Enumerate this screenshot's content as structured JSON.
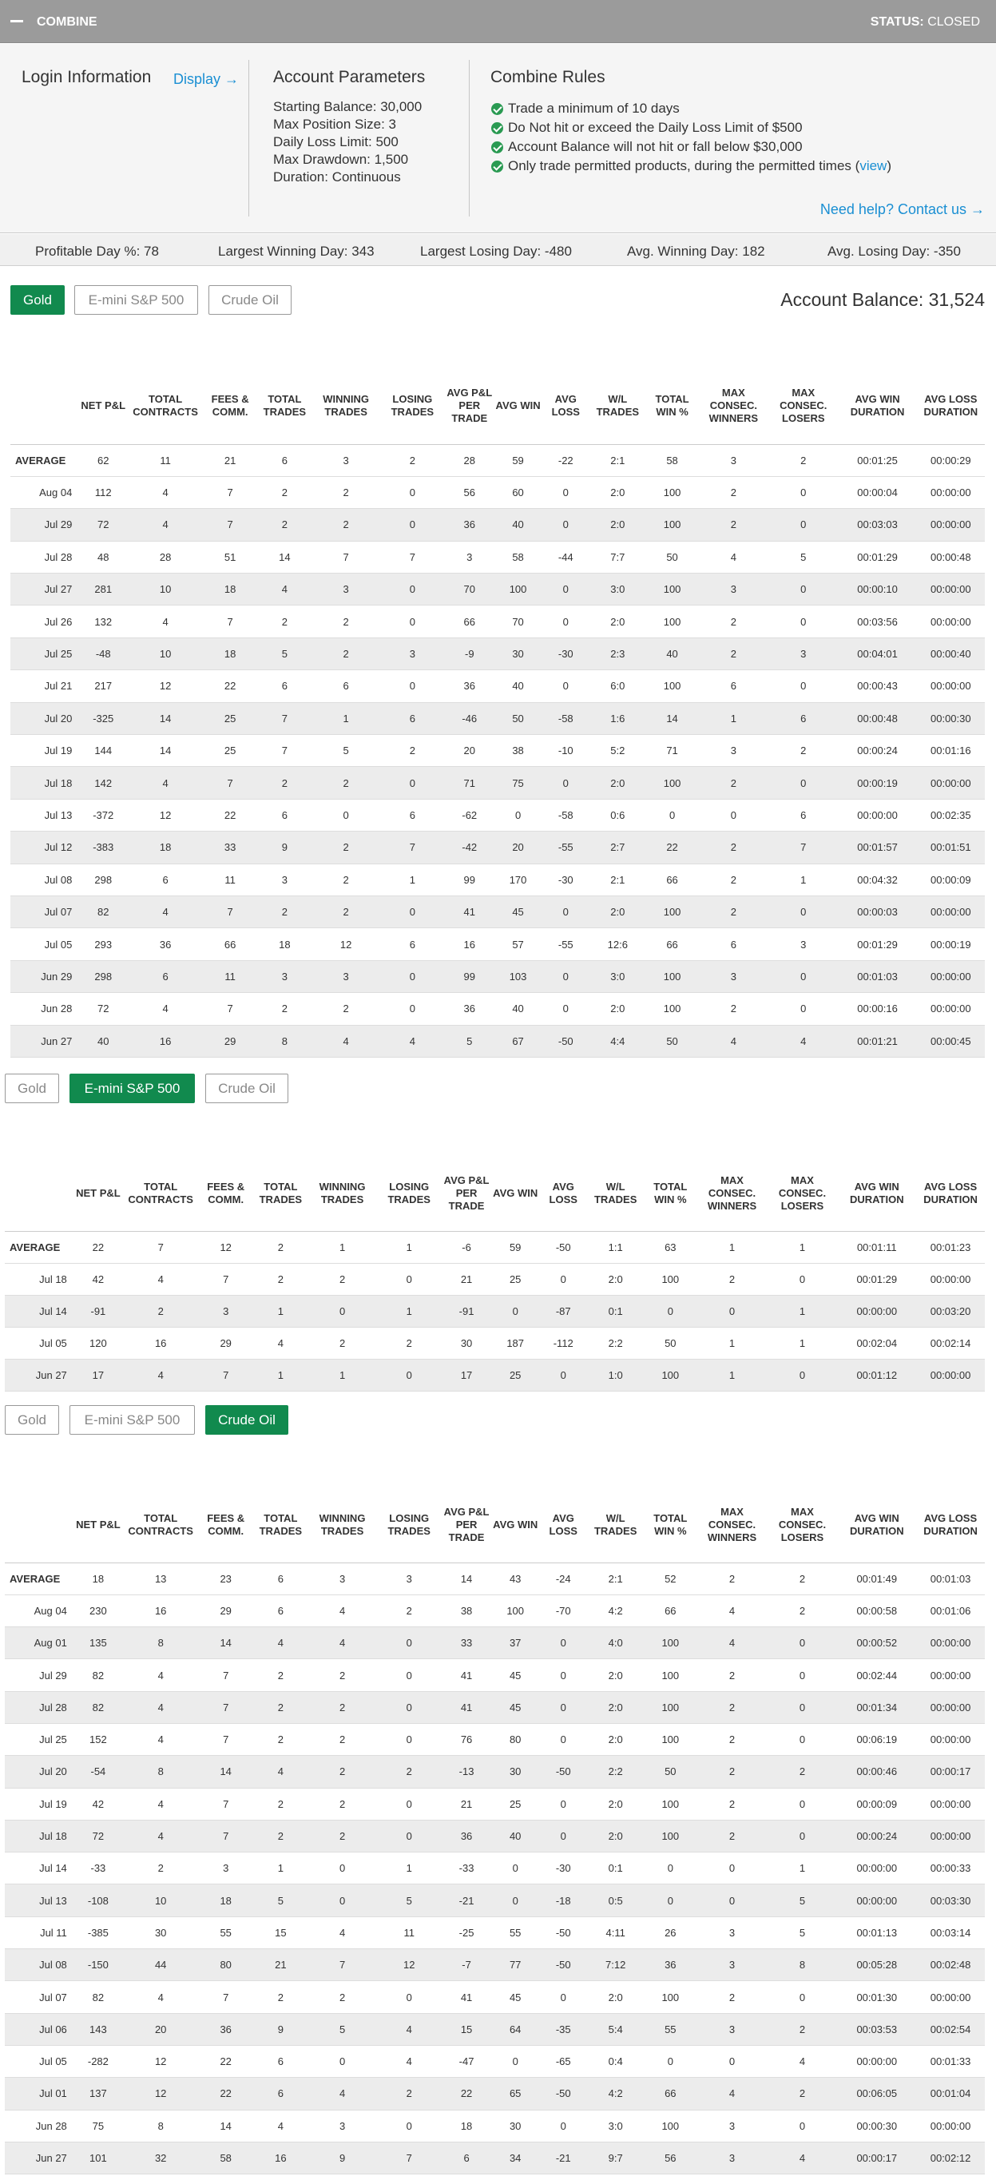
{
  "header": {
    "title": "COMBINE",
    "status_label": "STATUS:",
    "status_value": "CLOSED"
  },
  "login": {
    "heading": "Login Information",
    "display_link": "Display →"
  },
  "params": {
    "heading": "Account Parameters",
    "lines": [
      "Starting Balance: 30,000",
      "Max Position Size: 3",
      "Daily Loss Limit: 500",
      "Max Drawdown: 1,500",
      "Duration: Continuous"
    ]
  },
  "rules": {
    "heading": "Combine Rules",
    "items": [
      "Trade a minimum of 10 days",
      "Do Not hit or exceed the Daily Loss Limit of $500",
      "Account Balance will not hit or fall below $30,000"
    ],
    "last_prefix": "Only trade permitted products, during the permitted times (",
    "last_link": "view",
    "last_suffix": ")"
  },
  "help_link": "Need help? Contact us →",
  "stats": [
    "Profitable Day %: 78",
    "Largest Winning Day: 343",
    "Largest Losing Day: -480",
    "Avg. Winning Day: 182",
    "Avg. Losing Day: -350"
  ],
  "tabs": [
    "Gold",
    "E-mini S&P 500",
    "Crude Oil"
  ],
  "account_balance": "Account Balance: 31,524",
  "columns": [
    "",
    "NET P&L",
    "TOTAL CONTRACTS",
    "FEES & COMM.",
    "TOTAL TRADES",
    "WINNING TRADES",
    "LOSING TRADES",
    "AVG P&L PER TRADE",
    "AVG WIN",
    "AVG LOSS",
    "W/L TRADES",
    "TOTAL WIN %",
    "MAX CONSEC. WINNERS",
    "MAX CONSEC. LOSERS",
    "AVG WIN DURATION",
    "AVG LOSS DURATION"
  ],
  "tables": [
    {
      "product": "Gold",
      "rows": [
        [
          "AVERAGE",
          "62",
          "11",
          "21",
          "6",
          "3",
          "2",
          "28",
          "59",
          "-22",
          "2:1",
          "58",
          "3",
          "2",
          "00:01:25",
          "00:00:29"
        ],
        [
          "Aug 04",
          "112",
          "4",
          "7",
          "2",
          "2",
          "0",
          "56",
          "60",
          "0",
          "2:0",
          "100",
          "2",
          "0",
          "00:00:04",
          "00:00:00"
        ],
        [
          "Jul 29",
          "72",
          "4",
          "7",
          "2",
          "2",
          "0",
          "36",
          "40",
          "0",
          "2:0",
          "100",
          "2",
          "0",
          "00:03:03",
          "00:00:00"
        ],
        [
          "Jul 28",
          "48",
          "28",
          "51",
          "14",
          "7",
          "7",
          "3",
          "58",
          "-44",
          "7:7",
          "50",
          "4",
          "5",
          "00:01:29",
          "00:00:48"
        ],
        [
          "Jul 27",
          "281",
          "10",
          "18",
          "4",
          "3",
          "0",
          "70",
          "100",
          "0",
          "3:0",
          "100",
          "3",
          "0",
          "00:00:10",
          "00:00:00"
        ],
        [
          "Jul 26",
          "132",
          "4",
          "7",
          "2",
          "2",
          "0",
          "66",
          "70",
          "0",
          "2:0",
          "100",
          "2",
          "0",
          "00:03:56",
          "00:00:00"
        ],
        [
          "Jul 25",
          "-48",
          "10",
          "18",
          "5",
          "2",
          "3",
          "-9",
          "30",
          "-30",
          "2:3",
          "40",
          "2",
          "3",
          "00:04:01",
          "00:00:40"
        ],
        [
          "Jul 21",
          "217",
          "12",
          "22",
          "6",
          "6",
          "0",
          "36",
          "40",
          "0",
          "6:0",
          "100",
          "6",
          "0",
          "00:00:43",
          "00:00:00"
        ],
        [
          "Jul 20",
          "-325",
          "14",
          "25",
          "7",
          "1",
          "6",
          "-46",
          "50",
          "-58",
          "1:6",
          "14",
          "1",
          "6",
          "00:00:48",
          "00:00:30"
        ],
        [
          "Jul 19",
          "144",
          "14",
          "25",
          "7",
          "5",
          "2",
          "20",
          "38",
          "-10",
          "5:2",
          "71",
          "3",
          "2",
          "00:00:24",
          "00:01:16"
        ],
        [
          "Jul 18",
          "142",
          "4",
          "7",
          "2",
          "2",
          "0",
          "71",
          "75",
          "0",
          "2:0",
          "100",
          "2",
          "0",
          "00:00:19",
          "00:00:00"
        ],
        [
          "Jul 13",
          "-372",
          "12",
          "22",
          "6",
          "0",
          "6",
          "-62",
          "0",
          "-58",
          "0:6",
          "0",
          "0",
          "6",
          "00:00:00",
          "00:02:35"
        ],
        [
          "Jul 12",
          "-383",
          "18",
          "33",
          "9",
          "2",
          "7",
          "-42",
          "20",
          "-55",
          "2:7",
          "22",
          "2",
          "7",
          "00:01:57",
          "00:01:51"
        ],
        [
          "Jul 08",
          "298",
          "6",
          "11",
          "3",
          "2",
          "1",
          "99",
          "170",
          "-30",
          "2:1",
          "66",
          "2",
          "1",
          "00:04:32",
          "00:00:09"
        ],
        [
          "Jul 07",
          "82",
          "4",
          "7",
          "2",
          "2",
          "0",
          "41",
          "45",
          "0",
          "2:0",
          "100",
          "2",
          "0",
          "00:00:03",
          "00:00:00"
        ],
        [
          "Jul 05",
          "293",
          "36",
          "66",
          "18",
          "12",
          "6",
          "16",
          "57",
          "-55",
          "12:6",
          "66",
          "6",
          "3",
          "00:01:29",
          "00:00:19"
        ],
        [
          "Jun 29",
          "298",
          "6",
          "11",
          "3",
          "3",
          "0",
          "99",
          "103",
          "0",
          "3:0",
          "100",
          "3",
          "0",
          "00:01:03",
          "00:00:00"
        ],
        [
          "Jun 28",
          "72",
          "4",
          "7",
          "2",
          "2",
          "0",
          "36",
          "40",
          "0",
          "2:0",
          "100",
          "2",
          "0",
          "00:00:16",
          "00:00:00"
        ],
        [
          "Jun 27",
          "40",
          "16",
          "29",
          "8",
          "4",
          "4",
          "5",
          "67",
          "-50",
          "4:4",
          "50",
          "4",
          "4",
          "00:01:21",
          "00:00:45"
        ]
      ]
    },
    {
      "product": "E-mini S&P 500",
      "rows": [
        [
          "AVERAGE",
          "22",
          "7",
          "12",
          "2",
          "1",
          "1",
          "-6",
          "59",
          "-50",
          "1:1",
          "63",
          "1",
          "1",
          "00:01:11",
          "00:01:23"
        ],
        [
          "Jul 18",
          "42",
          "4",
          "7",
          "2",
          "2",
          "0",
          "21",
          "25",
          "0",
          "2:0",
          "100",
          "2",
          "0",
          "00:01:29",
          "00:00:00"
        ],
        [
          "Jul 14",
          "-91",
          "2",
          "3",
          "1",
          "0",
          "1",
          "-91",
          "0",
          "-87",
          "0:1",
          "0",
          "0",
          "1",
          "00:00:00",
          "00:03:20"
        ],
        [
          "Jul 05",
          "120",
          "16",
          "29",
          "4",
          "2",
          "2",
          "30",
          "187",
          "-112",
          "2:2",
          "50",
          "1",
          "1",
          "00:02:04",
          "00:02:14"
        ],
        [
          "Jun 27",
          "17",
          "4",
          "7",
          "1",
          "1",
          "0",
          "17",
          "25",
          "0",
          "1:0",
          "100",
          "1",
          "0",
          "00:01:12",
          "00:00:00"
        ]
      ]
    },
    {
      "product": "Crude Oil",
      "rows": [
        [
          "AVERAGE",
          "18",
          "13",
          "23",
          "6",
          "3",
          "3",
          "14",
          "43",
          "-24",
          "2:1",
          "52",
          "2",
          "2",
          "00:01:49",
          "00:01:03"
        ],
        [
          "Aug 04",
          "230",
          "16",
          "29",
          "6",
          "4",
          "2",
          "38",
          "100",
          "-70",
          "4:2",
          "66",
          "4",
          "2",
          "00:00:58",
          "00:01:06"
        ],
        [
          "Aug 01",
          "135",
          "8",
          "14",
          "4",
          "4",
          "0",
          "33",
          "37",
          "0",
          "4:0",
          "100",
          "4",
          "0",
          "00:00:52",
          "00:00:00"
        ],
        [
          "Jul 29",
          "82",
          "4",
          "7",
          "2",
          "2",
          "0",
          "41",
          "45",
          "0",
          "2:0",
          "100",
          "2",
          "0",
          "00:02:44",
          "00:00:00"
        ],
        [
          "Jul 28",
          "82",
          "4",
          "7",
          "2",
          "2",
          "0",
          "41",
          "45",
          "0",
          "2:0",
          "100",
          "2",
          "0",
          "00:01:34",
          "00:00:00"
        ],
        [
          "Jul 25",
          "152",
          "4",
          "7",
          "2",
          "2",
          "0",
          "76",
          "80",
          "0",
          "2:0",
          "100",
          "2",
          "0",
          "00:06:19",
          "00:00:00"
        ],
        [
          "Jul 20",
          "-54",
          "8",
          "14",
          "4",
          "2",
          "2",
          "-13",
          "30",
          "-50",
          "2:2",
          "50",
          "2",
          "2",
          "00:00:46",
          "00:00:17"
        ],
        [
          "Jul 19",
          "42",
          "4",
          "7",
          "2",
          "2",
          "0",
          "21",
          "25",
          "0",
          "2:0",
          "100",
          "2",
          "0",
          "00:00:09",
          "00:00:00"
        ],
        [
          "Jul 18",
          "72",
          "4",
          "7",
          "2",
          "2",
          "0",
          "36",
          "40",
          "0",
          "2:0",
          "100",
          "2",
          "0",
          "00:00:24",
          "00:00:00"
        ],
        [
          "Jul 14",
          "-33",
          "2",
          "3",
          "1",
          "0",
          "1",
          "-33",
          "0",
          "-30",
          "0:1",
          "0",
          "0",
          "1",
          "00:00:00",
          "00:00:33"
        ],
        [
          "Jul 13",
          "-108",
          "10",
          "18",
          "5",
          "0",
          "5",
          "-21",
          "0",
          "-18",
          "0:5",
          "0",
          "0",
          "5",
          "00:00:00",
          "00:03:30"
        ],
        [
          "Jul 11",
          "-385",
          "30",
          "55",
          "15",
          "4",
          "11",
          "-25",
          "55",
          "-50",
          "4:11",
          "26",
          "3",
          "5",
          "00:01:13",
          "00:03:14"
        ],
        [
          "Jul 08",
          "-150",
          "44",
          "80",
          "21",
          "7",
          "12",
          "-7",
          "77",
          "-50",
          "7:12",
          "36",
          "3",
          "8",
          "00:05:28",
          "00:02:48"
        ],
        [
          "Jul 07",
          "82",
          "4",
          "7",
          "2",
          "2",
          "0",
          "41",
          "45",
          "0",
          "2:0",
          "100",
          "2",
          "0",
          "00:01:30",
          "00:00:00"
        ],
        [
          "Jul 06",
          "143",
          "20",
          "36",
          "9",
          "5",
          "4",
          "15",
          "64",
          "-35",
          "5:4",
          "55",
          "3",
          "2",
          "00:03:53",
          "00:02:54"
        ],
        [
          "Jul 05",
          "-282",
          "12",
          "22",
          "6",
          "0",
          "4",
          "-47",
          "0",
          "-65",
          "0:4",
          "0",
          "0",
          "4",
          "00:00:00",
          "00:01:33"
        ],
        [
          "Jul 01",
          "137",
          "12",
          "22",
          "6",
          "4",
          "2",
          "22",
          "65",
          "-50",
          "4:2",
          "66",
          "4",
          "2",
          "00:06:05",
          "00:01:04"
        ],
        [
          "Jun 28",
          "75",
          "8",
          "14",
          "4",
          "3",
          "0",
          "18",
          "30",
          "0",
          "3:0",
          "100",
          "3",
          "0",
          "00:00:30",
          "00:00:00"
        ],
        [
          "Jun 27",
          "101",
          "32",
          "58",
          "16",
          "9",
          "7",
          "6",
          "34",
          "-21",
          "9:7",
          "56",
          "3",
          "4",
          "00:00:17",
          "00:02:12"
        ]
      ]
    }
  ]
}
